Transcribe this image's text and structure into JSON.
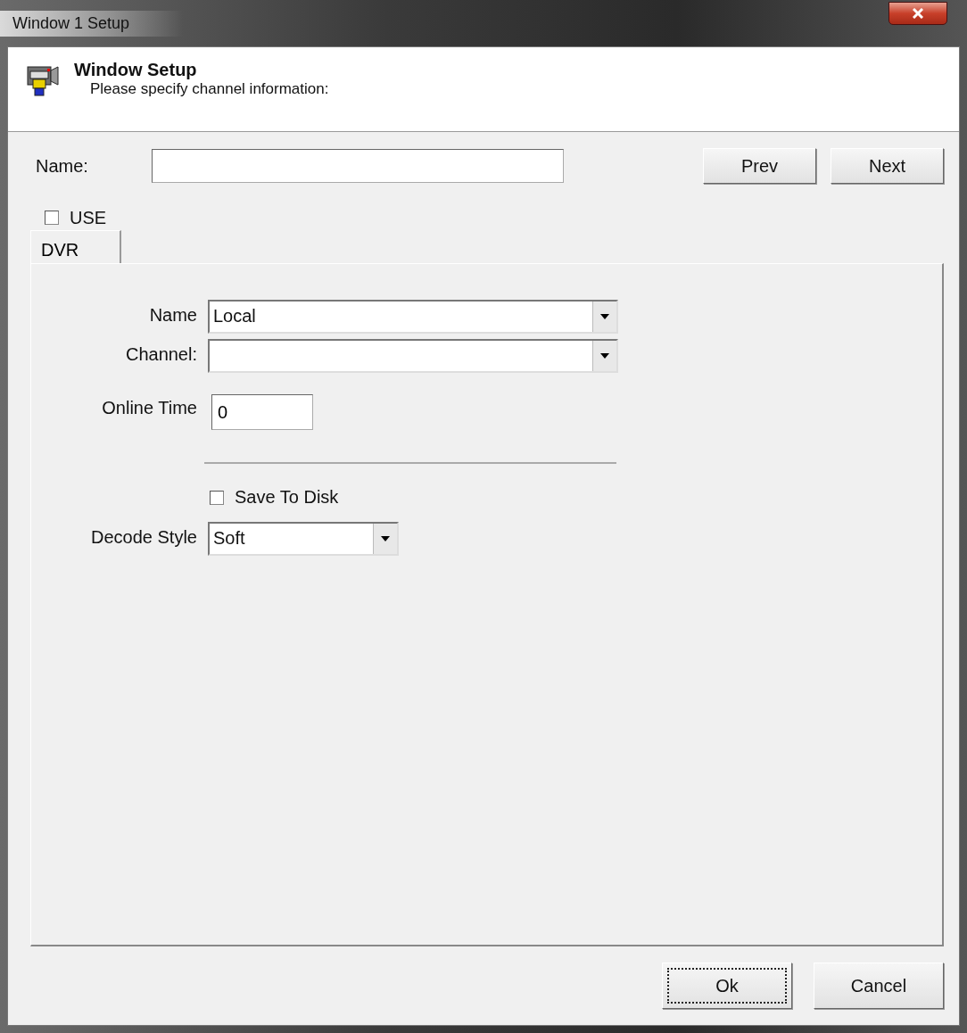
{
  "window": {
    "title": "Window 1 Setup"
  },
  "header": {
    "title": "Window Setup",
    "subtitle": "Please specify channel information:"
  },
  "name_field": {
    "label": "Name:"
  },
  "nav_buttons": [
    {
      "label": "Prev"
    },
    {
      "label": "Next"
    }
  ],
  "use_checkbox": {
    "label": "USE",
    "checked": false
  },
  "tabs": [
    {
      "label": "DVR",
      "selected": true
    }
  ],
  "form": [
    {
      "kind": "dropdown",
      "label": "Name",
      "value": "Local"
    },
    {
      "kind": "dropdown",
      "label": "Channel:"
    },
    {
      "kind": "field",
      "label": "Online Time",
      "value": "0"
    },
    {
      "kind": "separator"
    },
    {
      "kind": "checkbox",
      "label": "Save To Disk",
      "checked": false
    },
    {
      "kind": "dropdown_small",
      "label": "Decode Style",
      "value": "Soft"
    }
  ],
  "buttons": [
    {
      "label": "Ok",
      "focused": true
    },
    {
      "label": "Cancel",
      "focused": false
    }
  ]
}
